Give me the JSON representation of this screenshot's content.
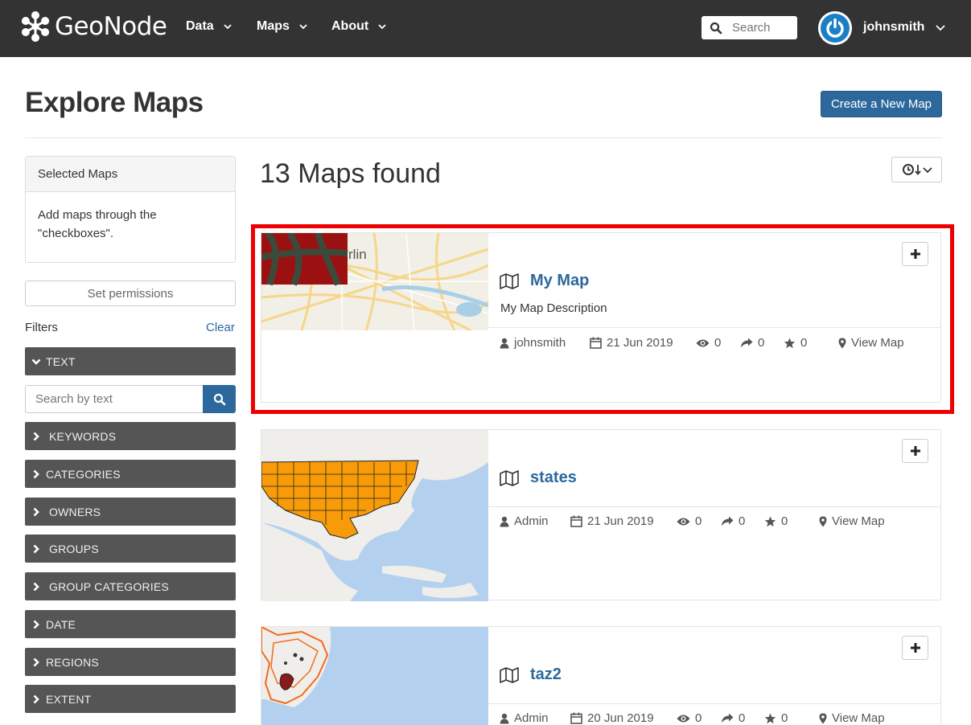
{
  "navbar": {
    "brand": "GeoNode",
    "menu": [
      {
        "label": "Data"
      },
      {
        "label": "Maps"
      },
      {
        "label": "About"
      }
    ],
    "search_placeholder": "Search",
    "username": "johnsmith"
  },
  "page": {
    "title": "Explore Maps",
    "create_button": "Create a New Map"
  },
  "sidebar": {
    "selected_heading": "Selected Maps",
    "selected_body_line1": "Add maps through the",
    "selected_body_line2": "\"checkboxes\".",
    "permissions_button": "Set permissions",
    "filters_label": "Filters",
    "clear_label": "Clear",
    "text_search_placeholder": "Search by text",
    "filters": [
      {
        "label": "TEXT",
        "expanded": true
      },
      {
        "label": "KEYWORDS",
        "expanded": false
      },
      {
        "label": "CATEGORIES",
        "expanded": false
      },
      {
        "label": "OWNERS",
        "expanded": false
      },
      {
        "label": "GROUPS",
        "expanded": false
      },
      {
        "label": "GROUP CATEGORIES",
        "expanded": false
      },
      {
        "label": "DATE",
        "expanded": false
      },
      {
        "label": "REGIONS",
        "expanded": false
      },
      {
        "label": "EXTENT",
        "expanded": false
      }
    ]
  },
  "results": {
    "count_text": "13 Maps found",
    "maps": [
      {
        "title": "My Map",
        "description": "My Map Description",
        "owner": "johnsmith",
        "date": "21 Jun 2019",
        "views": "0",
        "shares": "0",
        "rating": "0",
        "view_link": "View Map",
        "thumb_label": "rlin"
      },
      {
        "title": "states",
        "description": "",
        "owner": "Admin",
        "date": "21 Jun 2019",
        "views": "0",
        "shares": "0",
        "rating": "0",
        "view_link": "View Map"
      },
      {
        "title": "taz2",
        "description": "",
        "owner": "Admin",
        "date": "20 Jun 2019",
        "views": "0",
        "shares": "0",
        "rating": "0",
        "view_link": "View Map"
      }
    ]
  },
  "colors": {
    "navbar": "#333333",
    "primary": "#2c689c",
    "filter_bg": "#555555",
    "highlight": "#ee0000"
  },
  "icons": [
    "geonode-logo-icon",
    "chevron-down-icon",
    "search-icon",
    "user-avatar-icon",
    "chevron-right-icon",
    "clock-icon",
    "sort-icon",
    "map-icon",
    "user-icon",
    "calendar-icon",
    "eye-icon",
    "share-icon",
    "star-icon",
    "map-marker-icon",
    "plus-icon"
  ]
}
